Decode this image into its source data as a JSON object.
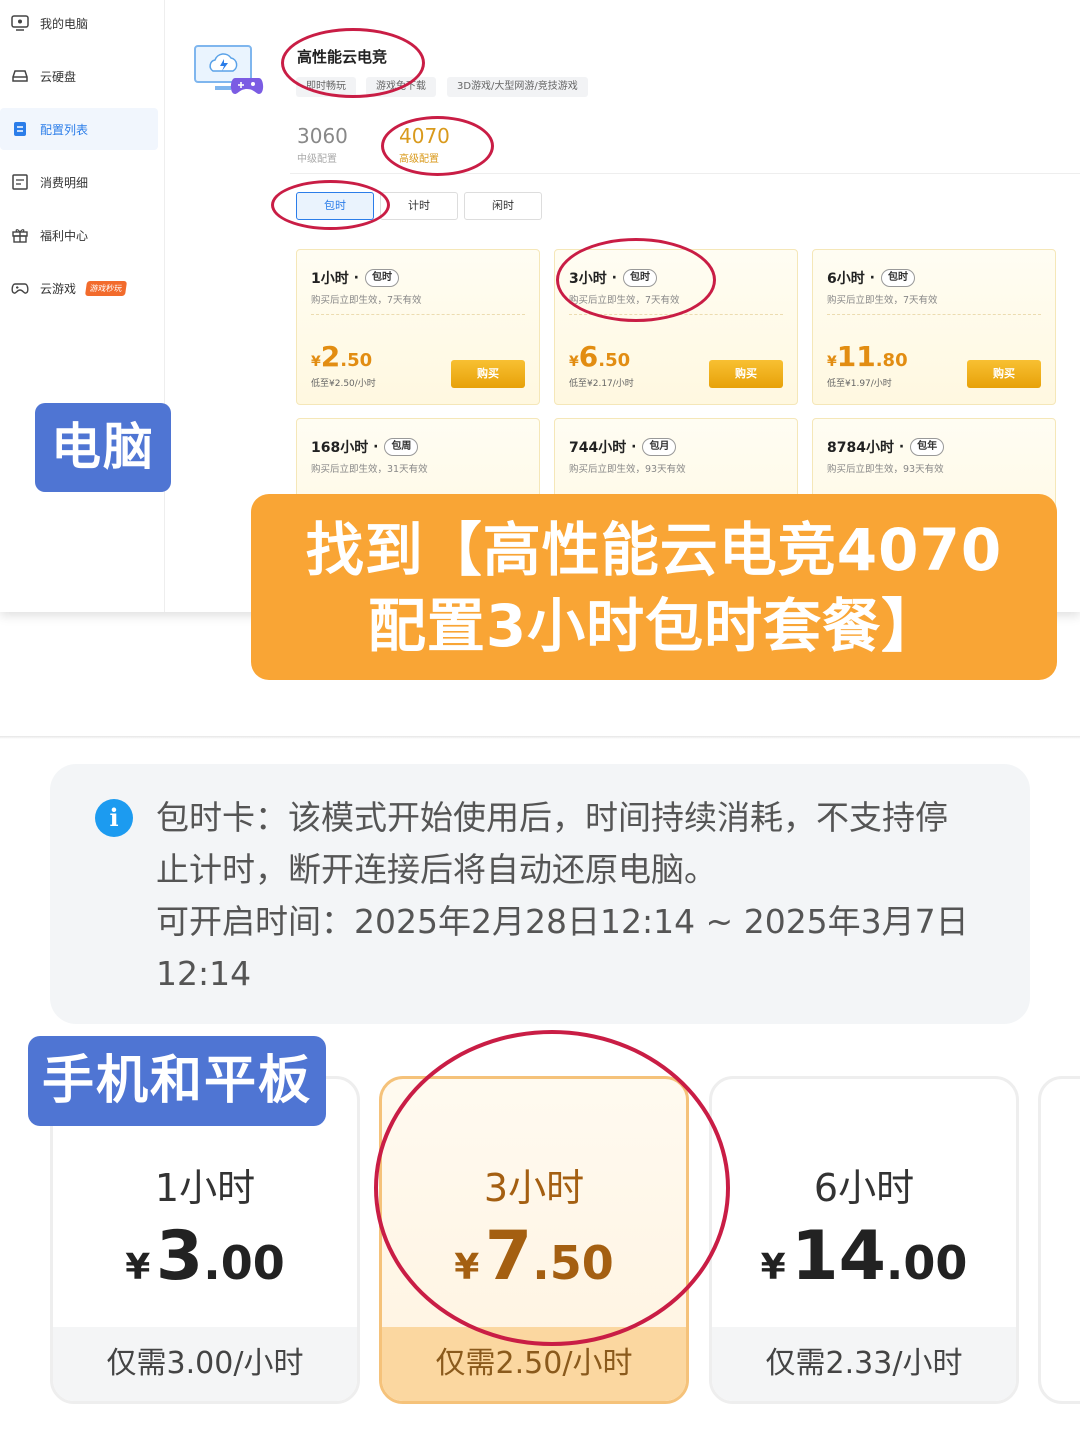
{
  "sidebar": {
    "items": [
      {
        "label": "我的电脑",
        "icon": "monitor-icon"
      },
      {
        "label": "云硬盘",
        "icon": "hard-disk-icon"
      },
      {
        "label": "配置列表",
        "icon": "clipboard-list-icon",
        "active": true
      },
      {
        "label": "消费明细",
        "icon": "receipt-icon"
      },
      {
        "label": "福利中心",
        "icon": "gift-icon"
      },
      {
        "label": "云游戏",
        "icon": "gamepad-icon",
        "badge": "游戏秒玩"
      }
    ]
  },
  "product": {
    "title": "高性能云电竞",
    "tags": [
      "即时畅玩",
      "游戏免下载",
      "3D游戏/大型网游/竞技游戏"
    ],
    "gpu_options": [
      {
        "num": "3060",
        "sub": "中级配置"
      },
      {
        "num": "4070",
        "sub": "高级配置",
        "selected": true
      }
    ],
    "modes": [
      "包时",
      "计时",
      "闲时"
    ],
    "plans": [
      {
        "hours": "1小时",
        "type": "包时",
        "desc": "购买后立即生效，7天有效",
        "cur": "¥",
        "int": "2",
        "dec": ".50",
        "low": "低至¥2.50/小时",
        "buy": "购买"
      },
      {
        "hours": "3小时",
        "type": "包时",
        "desc": "购买后立即生效，7天有效",
        "cur": "¥",
        "int": "6",
        "dec": ".50",
        "low": "低至¥2.17/小时",
        "buy": "购买"
      },
      {
        "hours": "6小时",
        "type": "包时",
        "desc": "购买后立即生效，7天有效",
        "cur": "¥",
        "int": "11",
        "dec": ".80",
        "low": "低至¥1.97/小时",
        "buy": "购买"
      },
      {
        "hours": "168小时",
        "type": "包周",
        "desc": "购买后立即生效，31天有效"
      },
      {
        "hours": "744小时",
        "type": "包月",
        "desc": "购买后立即生效，93天有效"
      },
      {
        "hours": "8784小时",
        "type": "包年",
        "desc": "购买后立即生效，93天有效"
      }
    ]
  },
  "overlays": {
    "pc_badge": "电脑",
    "banner_line1": "找到【高性能云电竞4070",
    "banner_line2": "配置3小时包时套餐】",
    "mobile_badge": "手机和平板"
  },
  "mobile": {
    "notice_lines": [
      "包时卡：该模式开始使用后，时间持续消耗，不支持停",
      "止计时，断开连接后将自动还原电脑。",
      "可开启时间：2025年2月28日12:14 ~ 2025年3月7日",
      "12:14"
    ],
    "plans": [
      {
        "hours": "1小时",
        "cur": "¥",
        "int": "3",
        "dec": ".00",
        "foot": "仅需3.00/小时"
      },
      {
        "hours": "3小时",
        "cur": "¥",
        "int": "7",
        "dec": ".50",
        "foot": "仅需2.50/小时",
        "selected": true
      },
      {
        "hours": "6小时",
        "cur": "¥",
        "int": "14",
        "dec": ".00",
        "foot": "仅需2.33/小时"
      }
    ]
  },
  "colors": {
    "accent_blue": "#2b7de9",
    "highlight_red": "#c91d45",
    "banner_orange": "#f9a535",
    "badge_blue": "#4f75d3",
    "price_orange": "#e28d12"
  }
}
